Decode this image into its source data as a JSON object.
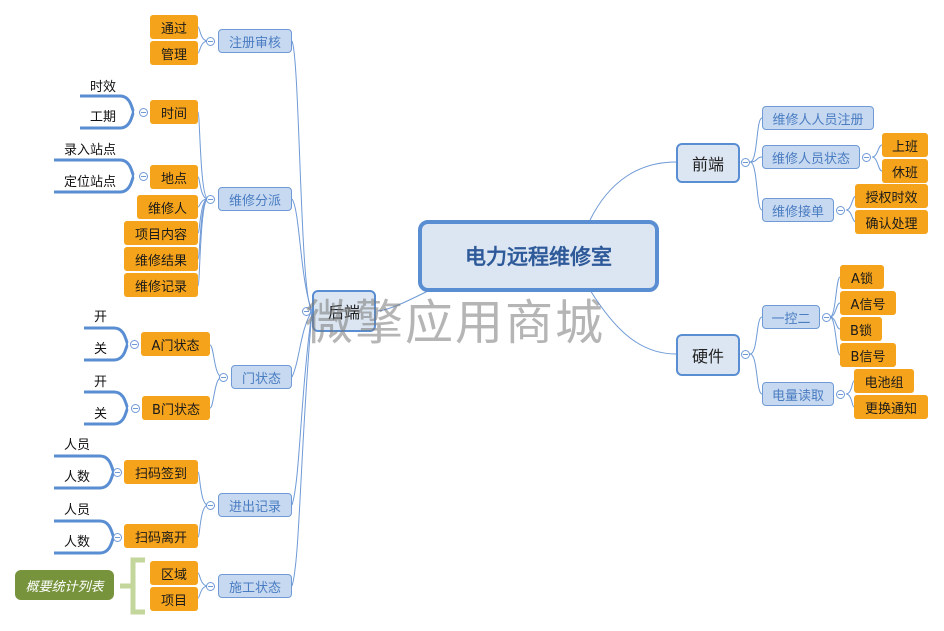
{
  "root": {
    "label": "电力远程维修室"
  },
  "watermark": "微擎应用商城",
  "frontend": {
    "label": "前端",
    "items": [
      {
        "label": "维修人人员注册"
      },
      {
        "label": "维修人员状态",
        "children": [
          "上班",
          "休班"
        ]
      },
      {
        "label": "维修接单",
        "children": [
          "授权时效",
          "确认处理"
        ]
      }
    ]
  },
  "hardware": {
    "label": "硬件",
    "items": [
      {
        "label": "一控二",
        "children": [
          "A锁",
          "A信号",
          "B锁",
          "B信号"
        ]
      },
      {
        "label": "电量读取",
        "children": [
          "电池组",
          "更换通知"
        ]
      }
    ]
  },
  "backend": {
    "label": "后端",
    "items": [
      {
        "label": "注册审核",
        "children": [
          "通过",
          "管理"
        ]
      },
      {
        "label": "维修分派",
        "children": [
          "时间",
          "地点",
          "维修人",
          "项目内容",
          "维修结果",
          "维修记录"
        ],
        "time_details": [
          "时效",
          "工期"
        ],
        "place_details": [
          "录入站点",
          "定位站点"
        ]
      },
      {
        "label": "门状态",
        "children": [
          "A门状态",
          "B门状态"
        ],
        "a_details": [
          "开",
          "关"
        ],
        "b_details": [
          "开",
          "关"
        ]
      },
      {
        "label": "进出记录",
        "children": [
          "扫码签到",
          "扫码离开"
        ],
        "in_details": [
          "人员",
          "人数"
        ],
        "out_details": [
          "人员",
          "人数"
        ]
      },
      {
        "label": "施工状态",
        "children": [
          "区域",
          "项目"
        ],
        "summary": "概要统计列表"
      }
    ]
  },
  "colors": {
    "leaf": "#f5a31a",
    "sub": "#c6d9f1",
    "main": "#dce6f2",
    "line": "#5a8ed2",
    "summary": "#77933c"
  }
}
